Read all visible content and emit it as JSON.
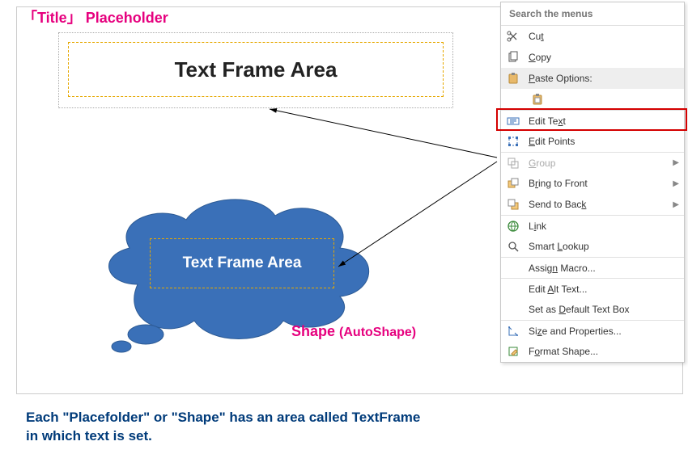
{
  "labels": {
    "title_bracket_left": "「",
    "title_word": "Title",
    "title_bracket_right": "」",
    "placeholder_word": "Placeholder",
    "text_frame_area1": "Text Frame Area",
    "text_frame_area2": "Text Frame Area",
    "shape_word": "Shape ",
    "shape_paren": "(AutoShape)"
  },
  "menu": {
    "search_placeholder": "Search the menus",
    "items": [
      {
        "key": "cut",
        "icon": "scissors",
        "label_pre": "",
        "label_u": "t",
        "label_post": "",
        "label_prefix": "Cu",
        "arrow": false,
        "disabled": false,
        "shaded": false
      },
      {
        "key": "copy",
        "icon": "copy",
        "label_prefix": "",
        "label_u": "C",
        "label_post": "opy",
        "arrow": false,
        "disabled": false,
        "shaded": false
      },
      {
        "key": "paste",
        "icon": "paste",
        "label_prefix": "",
        "label_u": "P",
        "label_post": "aste Options:",
        "arrow": false,
        "disabled": false,
        "shaded": true
      },
      {
        "key": "paste_clipboard",
        "icon": "clipboard",
        "indent": true,
        "label_prefix": "",
        "label_u": "",
        "label_post": "",
        "arrow": false,
        "disabled": false,
        "shaded": false
      },
      {
        "key": "edit_text",
        "icon": "edit-text",
        "sep": true,
        "label_prefix": "Edit Te",
        "label_u": "x",
        "label_post": "t",
        "arrow": false,
        "disabled": false,
        "shaded": false,
        "highlight": true
      },
      {
        "key": "edit_points",
        "icon": "edit-points",
        "label_prefix": "",
        "label_u": "E",
        "label_post": "dit Points",
        "arrow": false,
        "disabled": false,
        "shaded": false
      },
      {
        "key": "group",
        "icon": "group",
        "sep": true,
        "label_prefix": "",
        "label_u": "G",
        "label_post": "roup",
        "arrow": true,
        "disabled": true,
        "shaded": false
      },
      {
        "key": "bring_front",
        "icon": "bring-front",
        "label_prefix": "B",
        "label_u": "r",
        "label_post": "ing to Front",
        "arrow": true,
        "disabled": false,
        "shaded": false
      },
      {
        "key": "send_back",
        "icon": "send-back",
        "label_prefix": "Send to Bac",
        "label_u": "k",
        "label_post": "",
        "arrow": true,
        "disabled": false,
        "shaded": false
      },
      {
        "key": "link",
        "icon": "link",
        "sep": true,
        "label_prefix": "L",
        "label_u": "i",
        "label_post": "nk",
        "arrow": false,
        "disabled": false,
        "shaded": false
      },
      {
        "key": "smart_lookup",
        "icon": "smart-lookup",
        "label_prefix": "Smart ",
        "label_u": "L",
        "label_post": "ookup",
        "arrow": false,
        "disabled": false,
        "shaded": false
      },
      {
        "key": "assign_macro",
        "icon": "",
        "sep": true,
        "label_prefix": "Assig",
        "label_u": "n",
        "label_post": " Macro...",
        "arrow": false,
        "disabled": false,
        "shaded": false
      },
      {
        "key": "edit_alt",
        "icon": "",
        "sep": true,
        "label_prefix": "Edit ",
        "label_u": "A",
        "label_post": "lt Text...",
        "arrow": false,
        "disabled": false,
        "shaded": false
      },
      {
        "key": "set_default",
        "icon": "",
        "label_prefix": "Set as ",
        "label_u": "D",
        "label_post": "efault Text Box",
        "arrow": false,
        "disabled": false,
        "shaded": false
      },
      {
        "key": "size_props",
        "icon": "size-props",
        "sep": true,
        "label_prefix": "Si",
        "label_u": "z",
        "label_post": "e and Properties...",
        "arrow": false,
        "disabled": false,
        "shaded": false
      },
      {
        "key": "format_shape",
        "icon": "format-shape",
        "label_prefix": "F",
        "label_u": "o",
        "label_post": "rmat Shape...",
        "arrow": false,
        "disabled": false,
        "shaded": false
      }
    ]
  },
  "caption": {
    "line1": "Each \"Placefolder\" or \"Shape\" has an area called TextFrame",
    "line2": " in which text is set."
  },
  "colors": {
    "pink": "#e6007e",
    "blue_shape": "#3a70b8",
    "dark_blue": "#003b7a",
    "red_highlight": "#d40000"
  }
}
